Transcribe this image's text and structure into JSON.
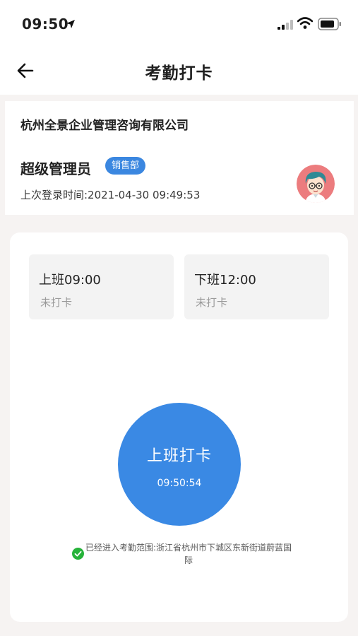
{
  "status_bar": {
    "time": "09:50",
    "icons": [
      "location-arrow-icon",
      "signal-icon",
      "wifi-icon",
      "battery-icon"
    ]
  },
  "nav": {
    "title": "考勤打卡",
    "back_icon": "back-arrow-icon"
  },
  "profile": {
    "company": "杭州全景企业管理咨询有限公司",
    "name": "超级管理员",
    "department": "销售部",
    "last_login": "上次登录时间:2021-04-30 09:49:53",
    "avatar_icon": "avatar-icon"
  },
  "shifts": [
    {
      "title": "上班09:00",
      "status": "未打卡"
    },
    {
      "title": "下班12:00",
      "status": "未打卡"
    }
  ],
  "clock_button": {
    "label": "上班打卡",
    "time": "09:50:54"
  },
  "range": {
    "text": "已经进入考勤范围:浙江省杭州市下城区东新街道蔚蓝国际",
    "icon": "check-circle-icon"
  },
  "colors": {
    "accent": "#3a89e4",
    "badge": "#3b87e0",
    "success": "#26b33a",
    "background": "#f6f3f2"
  }
}
